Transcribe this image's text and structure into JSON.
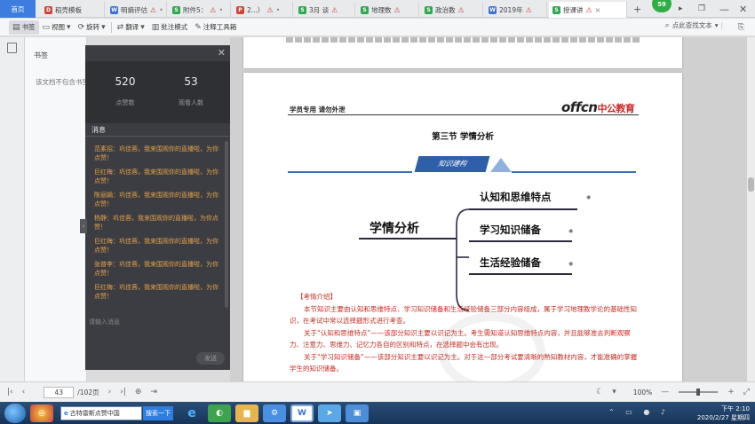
{
  "tabs": [
    {
      "label": "首页",
      "type": "home"
    },
    {
      "label": "稻壳模板",
      "icon_color": "#d0443a",
      "icon": "docer-icon"
    },
    {
      "label": "明熵评估",
      "icon_color": "#3d6fd6",
      "warn": true
    },
    {
      "label": "附件5：",
      "icon_color": "#2fa84f",
      "warn": true
    },
    {
      "label": "2...）",
      "icon_color": "#d0443a",
      "warn": true
    },
    {
      "label": "3月 谈",
      "icon_color": "#2fa84f",
      "warn": true
    },
    {
      "label": "地理数",
      "icon_color": "#2fa84f",
      "warn": true
    },
    {
      "label": "政治教",
      "icon_color": "#2fa84f",
      "warn": true
    },
    {
      "label": "2019年",
      "icon_color": "#3d6fd6",
      "warn": true
    },
    {
      "label": "授课讲",
      "icon_color": "#2fa84f",
      "warn": true,
      "active": true
    }
  ],
  "tabbar_badge": "59",
  "toolbar": {
    "bookmark": "书签",
    "view": "视图",
    "rotate": "旋转",
    "translate": "翻译",
    "annotate_mode": "批注模式",
    "annotate_tools": "注释工具箱",
    "search": "点此查找文本"
  },
  "bookmark_panel": {
    "title": "书签",
    "empty": "该文档不包含书签"
  },
  "live": {
    "likes": "520",
    "likes_label": "点赞数",
    "viewers": "53",
    "viewers_label": "观看人数",
    "messages_title": "消息",
    "messages": [
      "范素招：巩佳蓉，我来围观你的直播啦，为你点赞！",
      "巨红梅：巩佳蓉，我来围观你的直播啦，为你点赞！",
      "陈丽嫡：巩佳蓉，我来围观你的直播啦，为你点赞！",
      "杨静：巩佳蓉，我来围观你的直播啦，为你点赞！",
      "巨红梅：巩佳蓉，我来围观你的直播啦，为你点赞！",
      "张普李：巩佳蓉，我来围观你的直播啦，为你点赞！",
      "巨红梅：巩佳蓉，我来围观你的直播啦，为你点赞！"
    ],
    "input_placeholder": "请输入消息",
    "send": "发送"
  },
  "document": {
    "header_left": "学员专用 请勿外泄",
    "logo_latin": "offcn",
    "logo_cn": "中公教育",
    "section_title": "第三节 学情分析",
    "banner": "知识建构",
    "mindmap_root": "学情分析",
    "mindmap_nodes": [
      "认知和思维特点",
      "学习知识储备",
      "生活经验储备"
    ],
    "exam_intro_title": "【考情介绍】",
    "paragraphs": [
      "本节知识主要由认知和思维特点、学习知识储备和生活经验储备三部分内容组成，属于学习地理教学论的基础性知识，在考试中常以选择题形式进行考查。",
      "关于“认知和思维特点”——该部分知识主要以识记为主。考生需知道认知思维特点内容，并且能够准去判断观察力、注意力、思维力、记忆力各自的区别和特点，在选择题中会有出现。",
      "关于“学习知识储备”——该部分知识主要以识记为主。对于这一部分考试要清晰的熟知教材内容，才能准确的掌握学生的知识储备。"
    ]
  },
  "status": {
    "page": "43",
    "total": "/102页",
    "zoom": "100%",
    "zoom_fraction": 0.5
  },
  "taskbar": {
    "search_text": "古特雷斯点赞中国",
    "search_button": "搜索一下",
    "time": "下午 2:10",
    "date": "2020/2/27 星期四"
  }
}
